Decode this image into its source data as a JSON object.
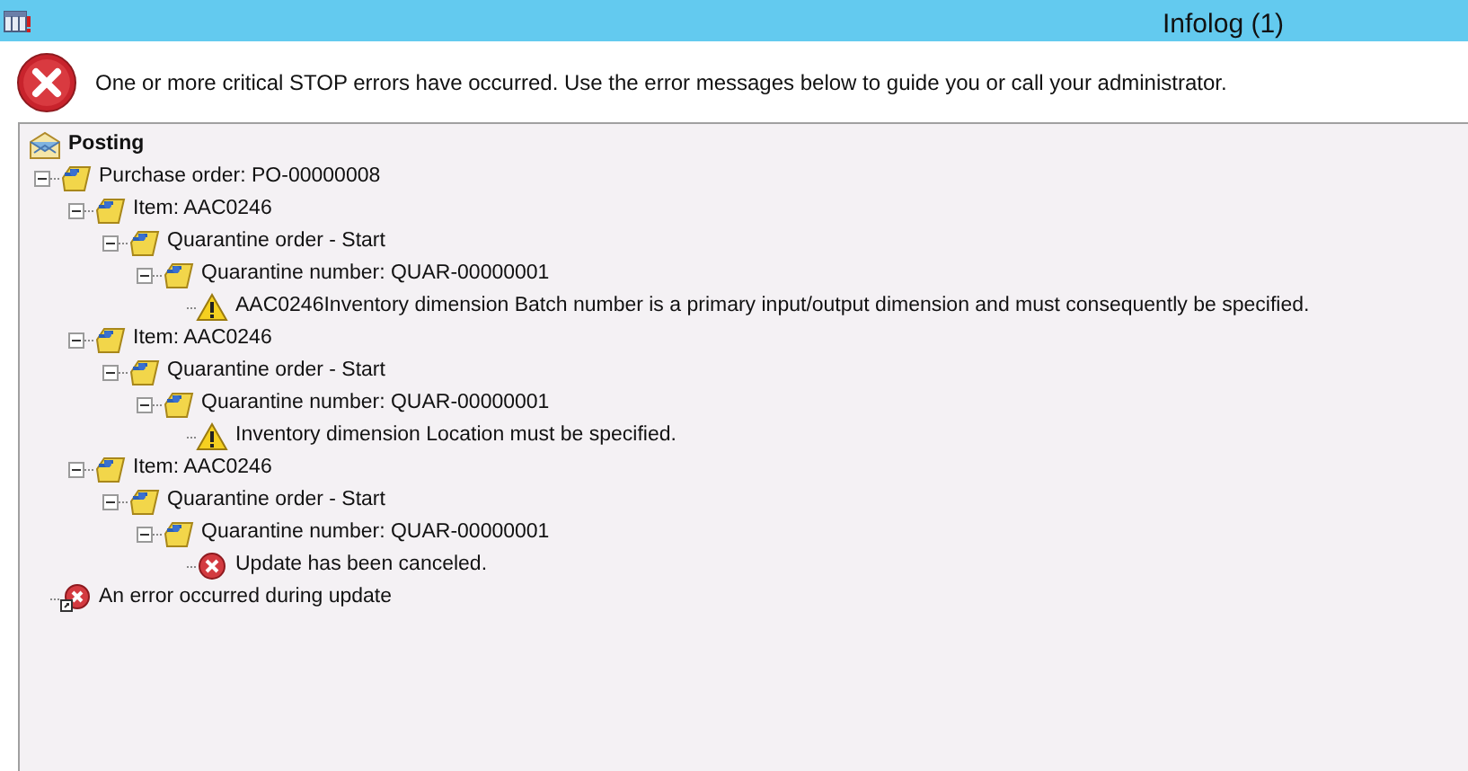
{
  "window": {
    "title": "Infolog (1)"
  },
  "message": "One or more critical STOP errors have occurred. Use the error messages below to guide you or call your administrator.",
  "tree": [
    {
      "kind": "root",
      "label": "Posting",
      "children": [
        {
          "kind": "folder",
          "label": "Purchase order: PO-00000008",
          "expanded": true,
          "children": [
            {
              "kind": "folder",
              "label": "Item: AAC0246",
              "expanded": true,
              "children": [
                {
                  "kind": "folder",
                  "label": "Quarantine order - Start",
                  "expanded": true,
                  "children": [
                    {
                      "kind": "folder",
                      "label": "Quarantine number: QUAR-00000001",
                      "expanded": true,
                      "children": [
                        {
                          "kind": "warning",
                          "label": "AAC0246Inventory dimension Batch number is a primary input/output dimension and must consequently be specified."
                        }
                      ]
                    }
                  ]
                }
              ]
            },
            {
              "kind": "folder",
              "label": "Item: AAC0246",
              "expanded": true,
              "children": [
                {
                  "kind": "folder",
                  "label": "Quarantine order - Start",
                  "expanded": true,
                  "children": [
                    {
                      "kind": "folder",
                      "label": "Quarantine number: QUAR-00000001",
                      "expanded": true,
                      "children": [
                        {
                          "kind": "warning",
                          "label": "Inventory dimension Location must be specified."
                        }
                      ]
                    }
                  ]
                }
              ]
            },
            {
              "kind": "folder",
              "label": "Item: AAC0246",
              "expanded": true,
              "children": [
                {
                  "kind": "folder",
                  "label": "Quarantine order - Start",
                  "expanded": true,
                  "children": [
                    {
                      "kind": "folder",
                      "label": "Quarantine number: QUAR-00000001",
                      "expanded": true,
                      "children": [
                        {
                          "kind": "error",
                          "label": "Update has been canceled."
                        }
                      ]
                    }
                  ]
                }
              ]
            }
          ]
        },
        {
          "kind": "error-link",
          "label": "An error occurred during update"
        }
      ]
    }
  ]
}
